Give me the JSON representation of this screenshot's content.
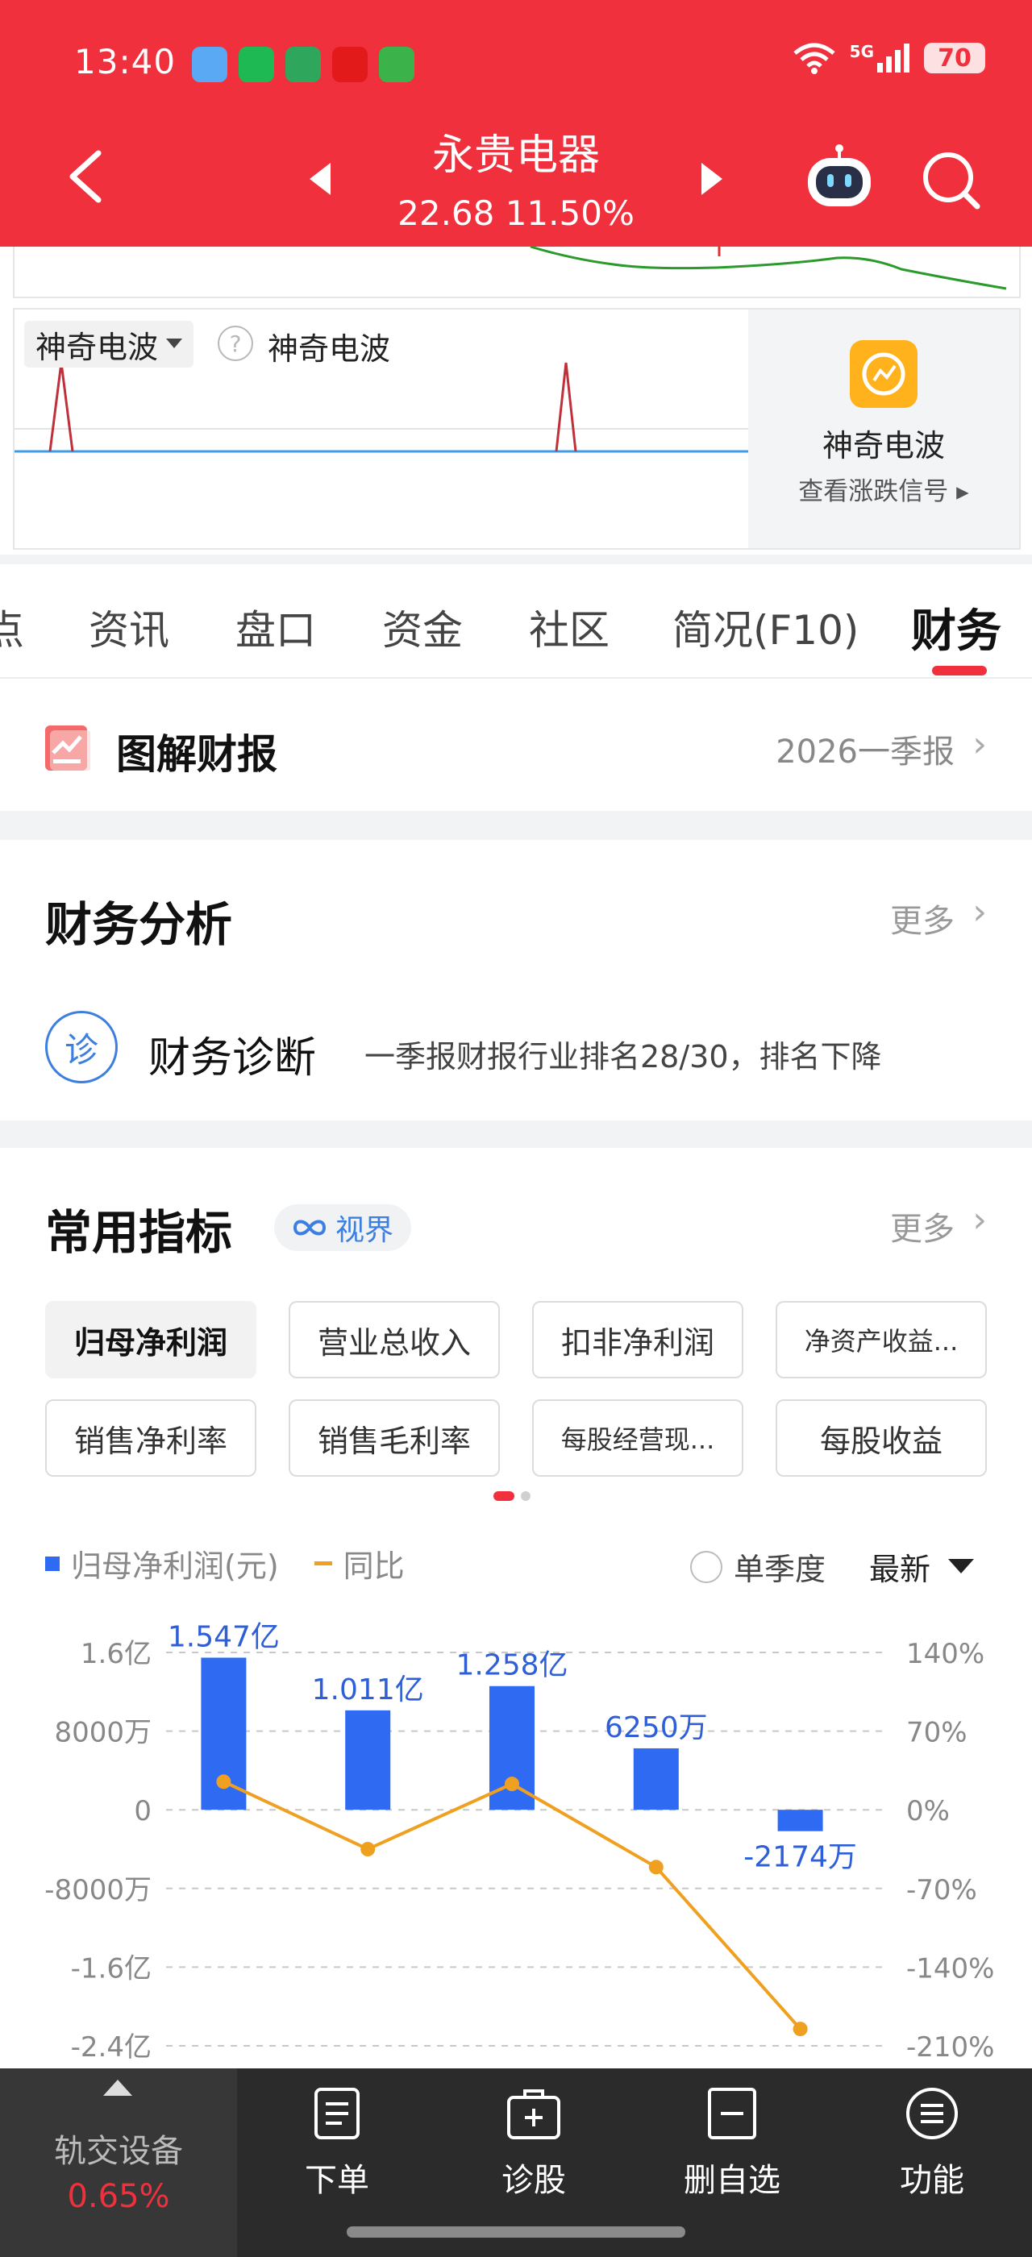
{
  "status_bar": {
    "time": "13:40",
    "network": "5G",
    "battery": "70"
  },
  "header": {
    "stock_name": "永贵电器",
    "price_line": "22.68 11.50%"
  },
  "indicator": {
    "selected": "神奇电波",
    "title": "神奇电波",
    "promo_title": "神奇电波",
    "promo_sub": "查看涨跌信号"
  },
  "tabs": [
    "点",
    "资讯",
    "盘口",
    "资金",
    "社区",
    "简况(F10)",
    "财务"
  ],
  "report": {
    "title": "图解财报",
    "period": "2026一季报"
  },
  "analysis": {
    "title": "财务分析",
    "more": "更多",
    "diag_icon": "诊",
    "diag_title": "财务诊断",
    "diag_desc": "一季报财报行业排名28/30，排名下降"
  },
  "indicators": {
    "title": "常用指标",
    "badge": "视界",
    "more": "更多",
    "chips": [
      "归母净利润",
      "营业总收入",
      "扣非净利润",
      "净资产收益...",
      "销售净利率",
      "销售毛利率",
      "每股经营现...",
      "每股收益"
    ]
  },
  "chart_controls": {
    "legend_bar": "归母净利润(元)",
    "legend_line": "同比",
    "single_quarter": "单季度",
    "period": "最新"
  },
  "chart_data": {
    "type": "bar",
    "left_axis_ticks": [
      "1.6亿",
      "8000万",
      "0",
      "-8000万",
      "-1.6亿",
      "-2.4亿"
    ],
    "right_axis_ticks": [
      "140%",
      "70%",
      "0%",
      "-70%",
      "-140%",
      "-210%"
    ],
    "ylim_left": [
      -2.4,
      1.6
    ],
    "ylim_right": [
      -210,
      140
    ],
    "series": [
      {
        "type": "bar",
        "values": [
          1.547,
          1.011,
          1.258,
          0.625,
          -0.2174
        ],
        "labels": [
          "1.547亿",
          "1.011亿",
          "1.258亿",
          "6250万",
          "-2174万"
        ]
      },
      {
        "type": "line",
        "values": [
          25,
          -35,
          23,
          -51,
          -195
        ]
      }
    ],
    "colors": {
      "bar": "#2e6bf2",
      "line": "#f0a020"
    }
  },
  "bottom_nav": {
    "stock": "轨交设备",
    "stock_change": "0.65%",
    "items": [
      "下单",
      "诊股",
      "删自选",
      "功能"
    ]
  }
}
